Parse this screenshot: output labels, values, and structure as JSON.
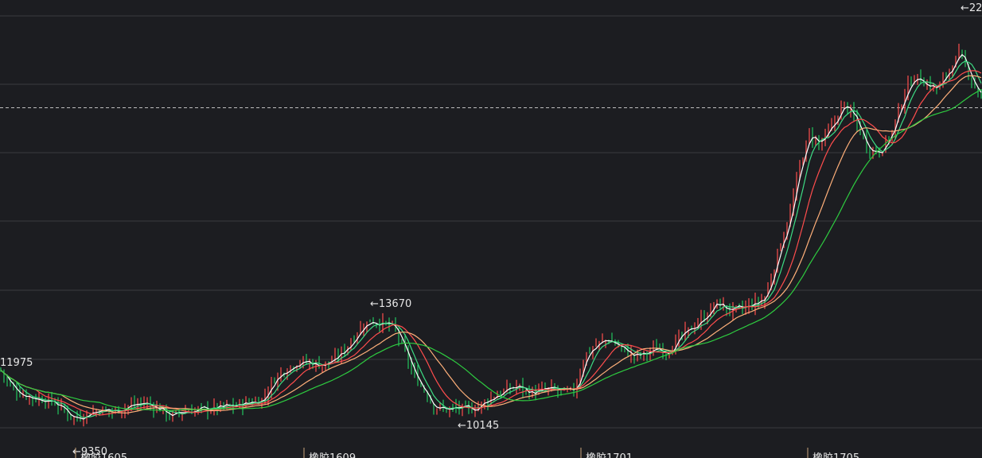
{
  "chart_data": {
    "type": "candlestick",
    "title": "",
    "ylim": [
      9000,
      22300
    ],
    "grid": true,
    "x_ticks": [
      "橡胶1605",
      "橡胶1609",
      "橡胶1701",
      "橡胶1705"
    ],
    "annotations": [
      {
        "label": "←13670",
        "value": 13670
      },
      {
        "label": "←10145",
        "value": 10145
      },
      {
        "label": "11975",
        "value": 11975
      },
      {
        "label": "←9350",
        "value": 9350
      },
      {
        "label": "←22",
        "value": 22000
      }
    ],
    "current_price": 19170,
    "ma_colors": {
      "ma1": "#ffffff",
      "ma2": "#3ddc84",
      "ma3": "#ff4d4d",
      "ma4": "#ffb07a",
      "ma5": "#2ecc40"
    },
    "colors": {
      "up": "#ff4d4d",
      "down": "#22c55e",
      "grid": "#3a3b40",
      "background": "#1c1d21"
    },
    "close_path": [
      [
        0,
        11600
      ],
      [
        12,
        11100
      ],
      [
        25,
        10900
      ],
      [
        40,
        10750
      ],
      [
        55,
        10700
      ],
      [
        70,
        10600
      ],
      [
        82,
        10350
      ],
      [
        95,
        10150
      ],
      [
        110,
        10300
      ],
      [
        125,
        10400
      ],
      [
        140,
        10350
      ],
      [
        160,
        10500
      ],
      [
        180,
        10600
      ],
      [
        200,
        10450
      ],
      [
        215,
        10200
      ],
      [
        230,
        10350
      ],
      [
        250,
        10400
      ],
      [
        270,
        10450
      ],
      [
        290,
        10500
      ],
      [
        310,
        10600
      ],
      [
        330,
        10700
      ],
      [
        345,
        11300
      ],
      [
        360,
        11600
      ],
      [
        375,
        11800
      ],
      [
        390,
        11750
      ],
      [
        405,
        11700
      ],
      [
        420,
        11850
      ],
      [
        435,
        12200
      ],
      [
        450,
        12700
      ],
      [
        465,
        13000
      ],
      [
        480,
        12900
      ],
      [
        495,
        12800
      ],
      [
        508,
        12100
      ],
      [
        520,
        11400
      ],
      [
        535,
        10900
      ],
      [
        545,
        10500
      ],
      [
        560,
        10400
      ],
      [
        575,
        10450
      ],
      [
        590,
        10400
      ],
      [
        605,
        10550
      ],
      [
        620,
        10800
      ],
      [
        635,
        10950
      ],
      [
        650,
        11100
      ],
      [
        665,
        10900
      ],
      [
        680,
        10950
      ],
      [
        695,
        11000
      ],
      [
        710,
        10900
      ],
      [
        722,
        10950
      ],
      [
        735,
        12000
      ],
      [
        750,
        12300
      ],
      [
        765,
        12450
      ],
      [
        780,
        12200
      ],
      [
        795,
        11950
      ],
      [
        810,
        12000
      ],
      [
        825,
        12200
      ],
      [
        840,
        12100
      ],
      [
        855,
        12500
      ],
      [
        870,
        12800
      ],
      [
        885,
        13100
      ],
      [
        900,
        13500
      ],
      [
        915,
        13300
      ],
      [
        930,
        13300
      ],
      [
        945,
        13450
      ],
      [
        960,
        13600
      ],
      [
        970,
        14300
      ],
      [
        980,
        15200
      ],
      [
        992,
        16000
      ],
      [
        1005,
        17500
      ],
      [
        1017,
        18400
      ],
      [
        1030,
        18100
      ],
      [
        1045,
        18600
      ],
      [
        1060,
        19300
      ],
      [
        1075,
        18800
      ],
      [
        1090,
        18000
      ],
      [
        1105,
        17900
      ],
      [
        1120,
        18400
      ],
      [
        1135,
        19500
      ],
      [
        1148,
        20100
      ],
      [
        1162,
        19900
      ],
      [
        1178,
        19700
      ],
      [
        1193,
        20300
      ],
      [
        1205,
        20700
      ],
      [
        1215,
        20300
      ],
      [
        1225,
        19800
      ],
      [
        1234,
        19400
      ]
    ]
  }
}
